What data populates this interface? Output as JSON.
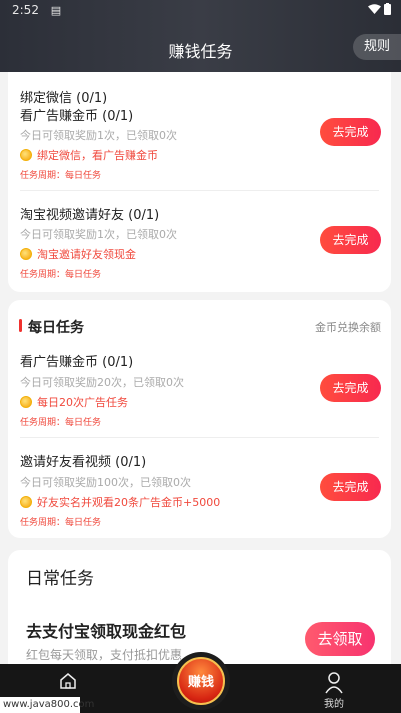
{
  "status_bar": {
    "time": "2:52",
    "sim_icon": "sim-card-icon",
    "wifi_icon": "wifi-icon",
    "battery_icon": "battery-icon"
  },
  "header": {
    "title": "赚钱任务",
    "rules_label": "规则"
  },
  "top_tasks": [
    {
      "names": [
        "绑定微信 (0/1)",
        "看广告赚金币 (0/1)"
      ],
      "quota": "今日可领取奖励1次，已领取0次",
      "reward": "绑定微信，看广告赚金币",
      "period": "任务周期：每日任务",
      "button": "去完成"
    },
    {
      "names": [
        "淘宝视频邀请好友 (0/1)"
      ],
      "quota": "今日可领取奖励1次，已领取0次",
      "reward": "淘宝邀请好友领现金",
      "period": "任务周期：每日任务",
      "button": "去完成"
    }
  ],
  "daily_section": {
    "title": "每日任务",
    "link": "金币兑换余额",
    "tasks": [
      {
        "name": "看广告赚金币 (0/1)",
        "quota": "今日可领取奖励20次，已领取0次",
        "reward": "每日20次广告任务",
        "period": "任务周期：每日任务",
        "button": "去完成"
      },
      {
        "name": "邀请好友看视频 (0/1)",
        "quota": "今日可领取奖励100次，已领取0次",
        "reward": "好友实名并观看20条广告金币+5000",
        "period": "任务周期：每日任务",
        "button": "去完成"
      }
    ]
  },
  "routine_section": {
    "title": "日常任务",
    "alipay_title": "去支付宝领取现金红包",
    "alipay_sub": "红包每天领取，支付抵扣优惠",
    "alipay_button": "去领取"
  },
  "tabbar": {
    "home_icon": "home-icon",
    "center_label": "赚钱",
    "me_label": "我的",
    "me_icon": "user-icon"
  },
  "watermark": "www.java800.com",
  "colors": {
    "accent": "#f8294f",
    "reward_text": "#f0493d",
    "header_bg": "#2c2f38",
    "tabbar_bg": "#161616"
  }
}
